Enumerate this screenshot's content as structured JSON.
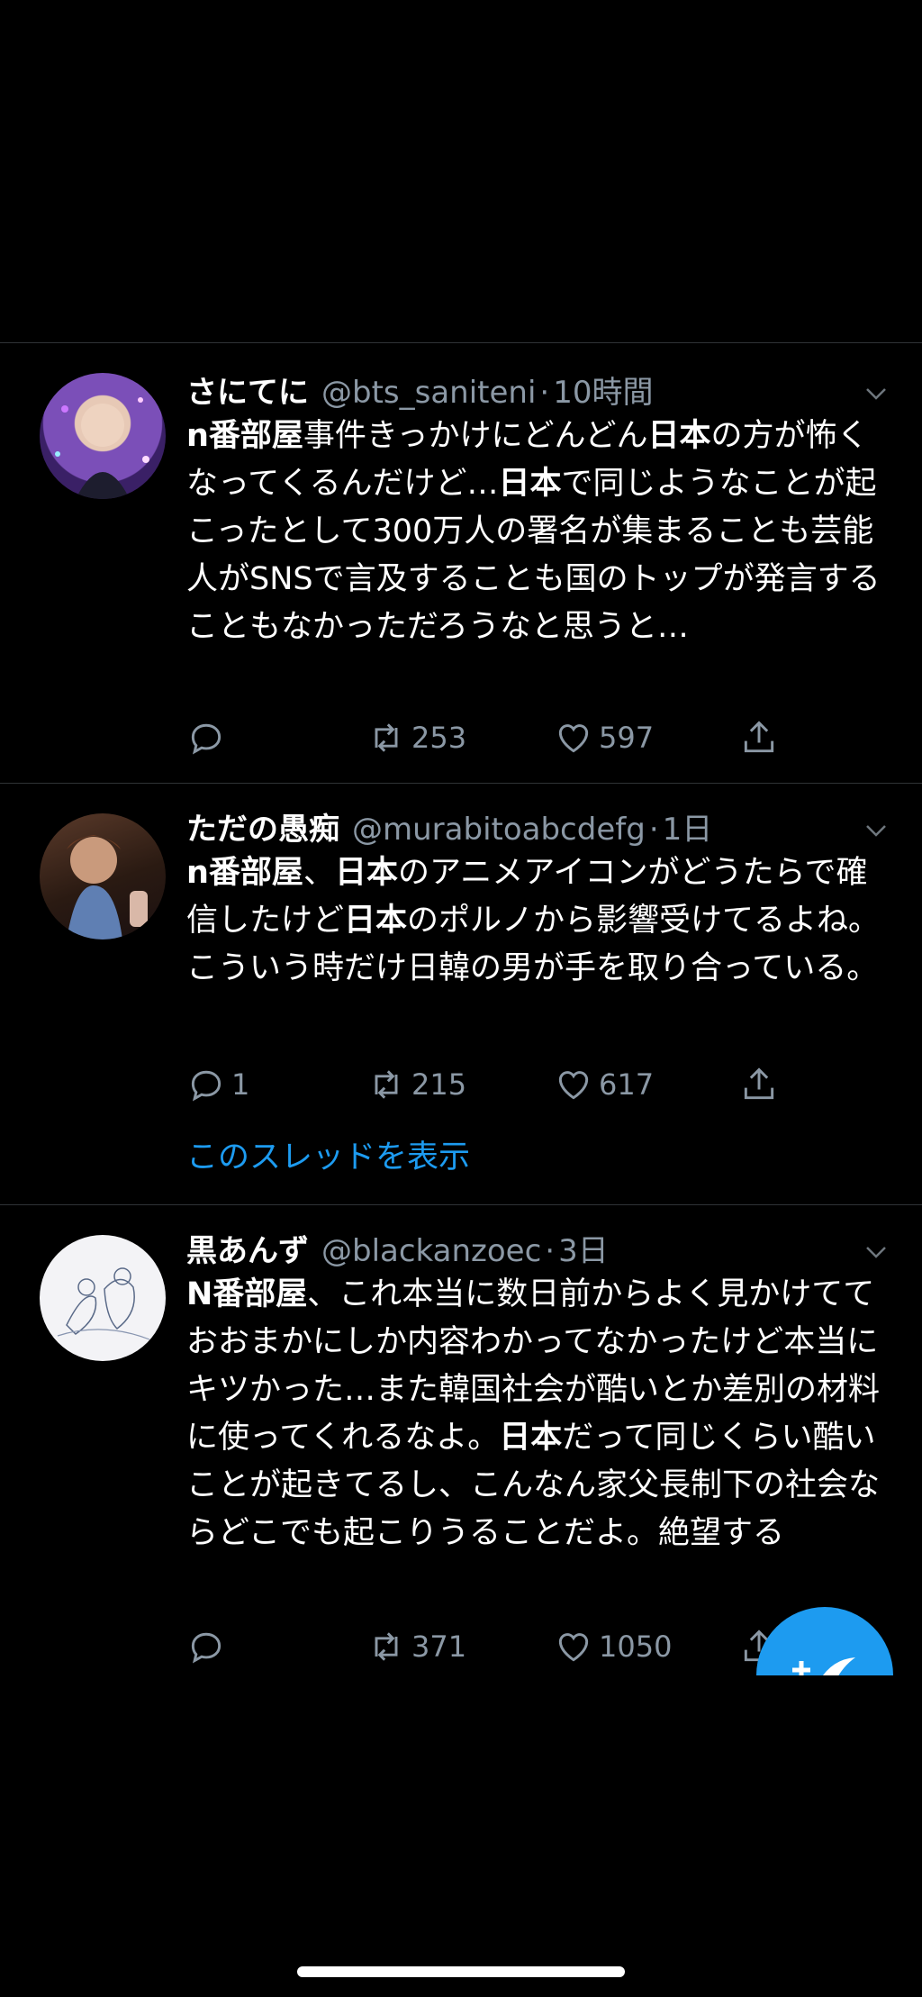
{
  "tweets": [
    {
      "name": "さにてに",
      "handle": "@bts_saniteni",
      "dot": "·",
      "time": "10時間",
      "body": [
        {
          "t": "n番部屋",
          "b": true
        },
        {
          "t": "事件きっかけにどんどん",
          "b": false
        },
        {
          "t": "日本",
          "b": true
        },
        {
          "t": "の方が怖くなってくるんだけど…",
          "b": false
        },
        {
          "t": "日本",
          "b": true
        },
        {
          "t": "で同じようなことが起こったとして300万人の署名が集まることも芸能人がSNSで言及することも国のトップが発言することもなかっただろうなと思うと…",
          "b": false
        }
      ],
      "replies": "",
      "retweets": "253",
      "likes": "597",
      "thread_link": ""
    },
    {
      "name": "ただの愚痴",
      "handle": "@murabitoabcdefg",
      "dot": "·",
      "time": "1日",
      "body": [
        {
          "t": "n番部屋",
          "b": true
        },
        {
          "t": "、",
          "b": false
        },
        {
          "t": "日本",
          "b": true
        },
        {
          "t": "のアニメアイコンがどうたらで確信したけど",
          "b": false
        },
        {
          "t": "日本",
          "b": true
        },
        {
          "t": "のポルノから影響受けてるよね。こういう時だけ日韓の男が手を取り合っている。",
          "b": false
        }
      ],
      "replies": "1",
      "retweets": "215",
      "likes": "617",
      "thread_link": "このスレッドを表示"
    },
    {
      "name": "黒あんず",
      "handle": "@blackanzoec",
      "dot": "·",
      "time": "3日",
      "body": [
        {
          "t": "N番部屋",
          "b": true
        },
        {
          "t": "、これ本当に数日前からよく見かけてておおまかにしか内容わかってなかったけど本当にキツかった…また韓国社会が酷いとか差別の材料に使ってくれるなよ。",
          "b": false
        },
        {
          "t": "日本",
          "b": true
        },
        {
          "t": "だって同じくらい酷いことが起きてるし、こんなん家父長制下の社会ならどこでも起こりうることだよ。絶望する",
          "b": false
        }
      ],
      "replies": "",
      "retweets": "371",
      "likes": "1050",
      "thread_link": ""
    }
  ],
  "icons": {
    "reply": "reply-icon",
    "retweet": "retweet-icon",
    "like": "like-icon",
    "share": "share-icon",
    "caret": "chevron-down-icon",
    "fab": "compose-tweet-icon"
  },
  "colors": {
    "background": "#000000",
    "text": "#ffffff",
    "secondary": "#8b98a5",
    "accent": "#1d9bf0",
    "divider": "#2f3336"
  }
}
